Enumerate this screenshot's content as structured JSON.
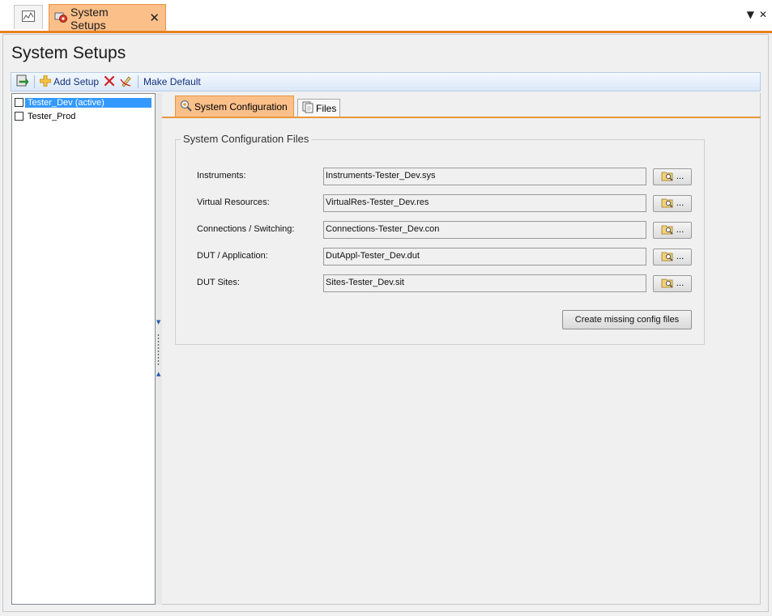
{
  "document_tabs": {
    "active_label": "System Setups"
  },
  "page": {
    "title": "System Setups"
  },
  "toolbar": {
    "add_setup": "Add Setup",
    "make_default": "Make Default"
  },
  "setups": [
    {
      "label": "Tester_Dev (active)",
      "selected": true
    },
    {
      "label": "Tester_Prod",
      "selected": false
    }
  ],
  "tabs": {
    "system_configuration": "System Configuration",
    "files": "Files"
  },
  "config_group": {
    "title": "System Configuration Files",
    "rows": [
      {
        "label": "Instruments:",
        "value": "Instruments-Tester_Dev.sys"
      },
      {
        "label": "Virtual Resources:",
        "value": "VirtualRes-Tester_Dev.res"
      },
      {
        "label": "Connections / Switching:",
        "value": "Connections-Tester_Dev.con"
      },
      {
        "label": "DUT / Application:",
        "value": "DutAppl-Tester_Dev.dut"
      },
      {
        "label": "DUT Sites:",
        "value": "Sites-Tester_Dev.sit"
      }
    ],
    "browse_label": "...",
    "create_button": "Create missing config files"
  },
  "colors": {
    "accent_orange": "#e8801b",
    "selection_blue": "#3399ff",
    "toolbar_text": "#15307a"
  }
}
